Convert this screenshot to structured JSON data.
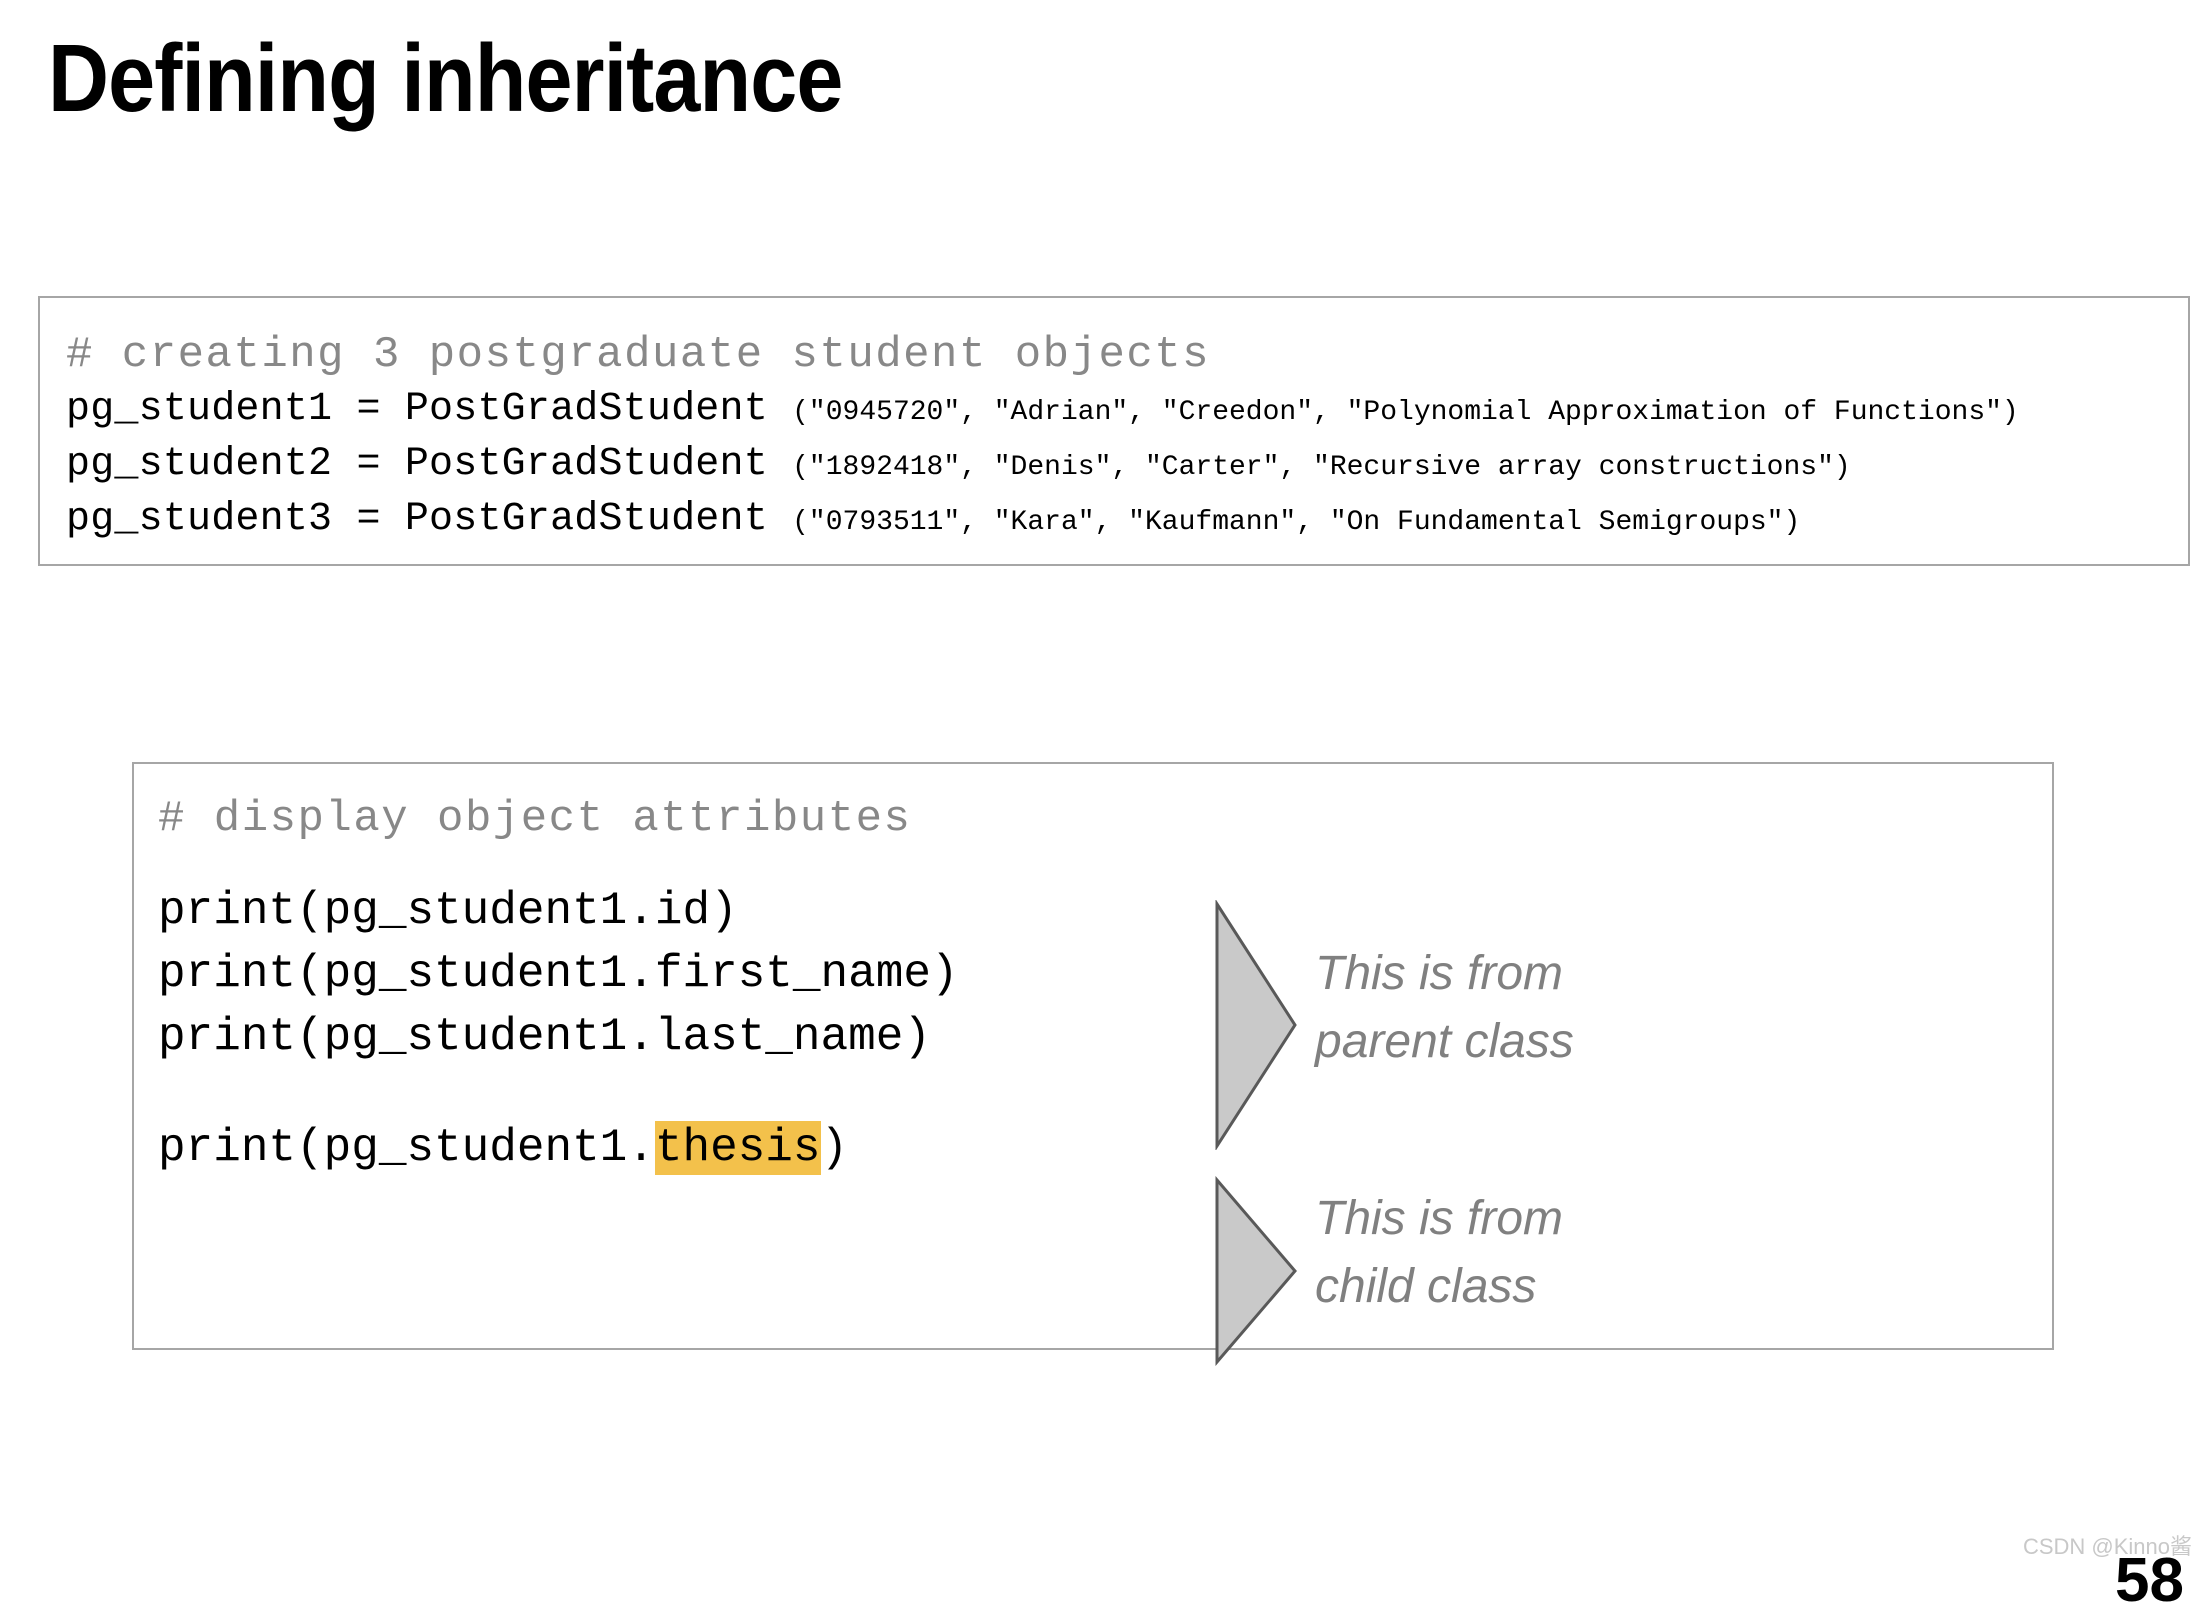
{
  "slide": {
    "title": "Defining inheritance"
  },
  "code_top": {
    "comment": "# creating 3 postgraduate student objects",
    "lines": [
      {
        "head": "pg_student1 = PostGradStudent ",
        "args": "(\"0945720\", \"Adrian\", \"Creedon\", \"Polynomial Approximation of Functions\")"
      },
      {
        "head": "pg_student2 = PostGradStudent ",
        "args": "(\"1892418\", \"Denis\", \"Carter\", \"Recursive array constructions\")"
      },
      {
        "head": "pg_student3 = PostGradStudent ",
        "args": "(\"0793511\", \"Kara\", \"Kaufmann\", \"On Fundamental Semigroups\")"
      }
    ]
  },
  "code_bottom": {
    "comment": "# display object attributes",
    "print_id": "print(pg_student1.id)",
    "print_first_name": "print(pg_student1.first_name)",
    "print_last_name": "print(pg_student1.last_name)",
    "print_thesis_prefix": "print(pg_student1.",
    "print_thesis_highlight": "thesis",
    "print_thesis_suffix": ")"
  },
  "annotations": [
    {
      "text": "This is from\nparent class"
    },
    {
      "text": "This is from\nchild class"
    }
  ],
  "footer": {
    "watermark": "CSDN @Kinno酱",
    "page_number": "58"
  },
  "colors": {
    "highlight": "#f3c14b",
    "comment_gray": "#888888",
    "annotation_gray": "#808080",
    "border_gray": "#a6a6a6",
    "arrow_fill": "#c9c9c9",
    "arrow_stroke": "#595959"
  }
}
